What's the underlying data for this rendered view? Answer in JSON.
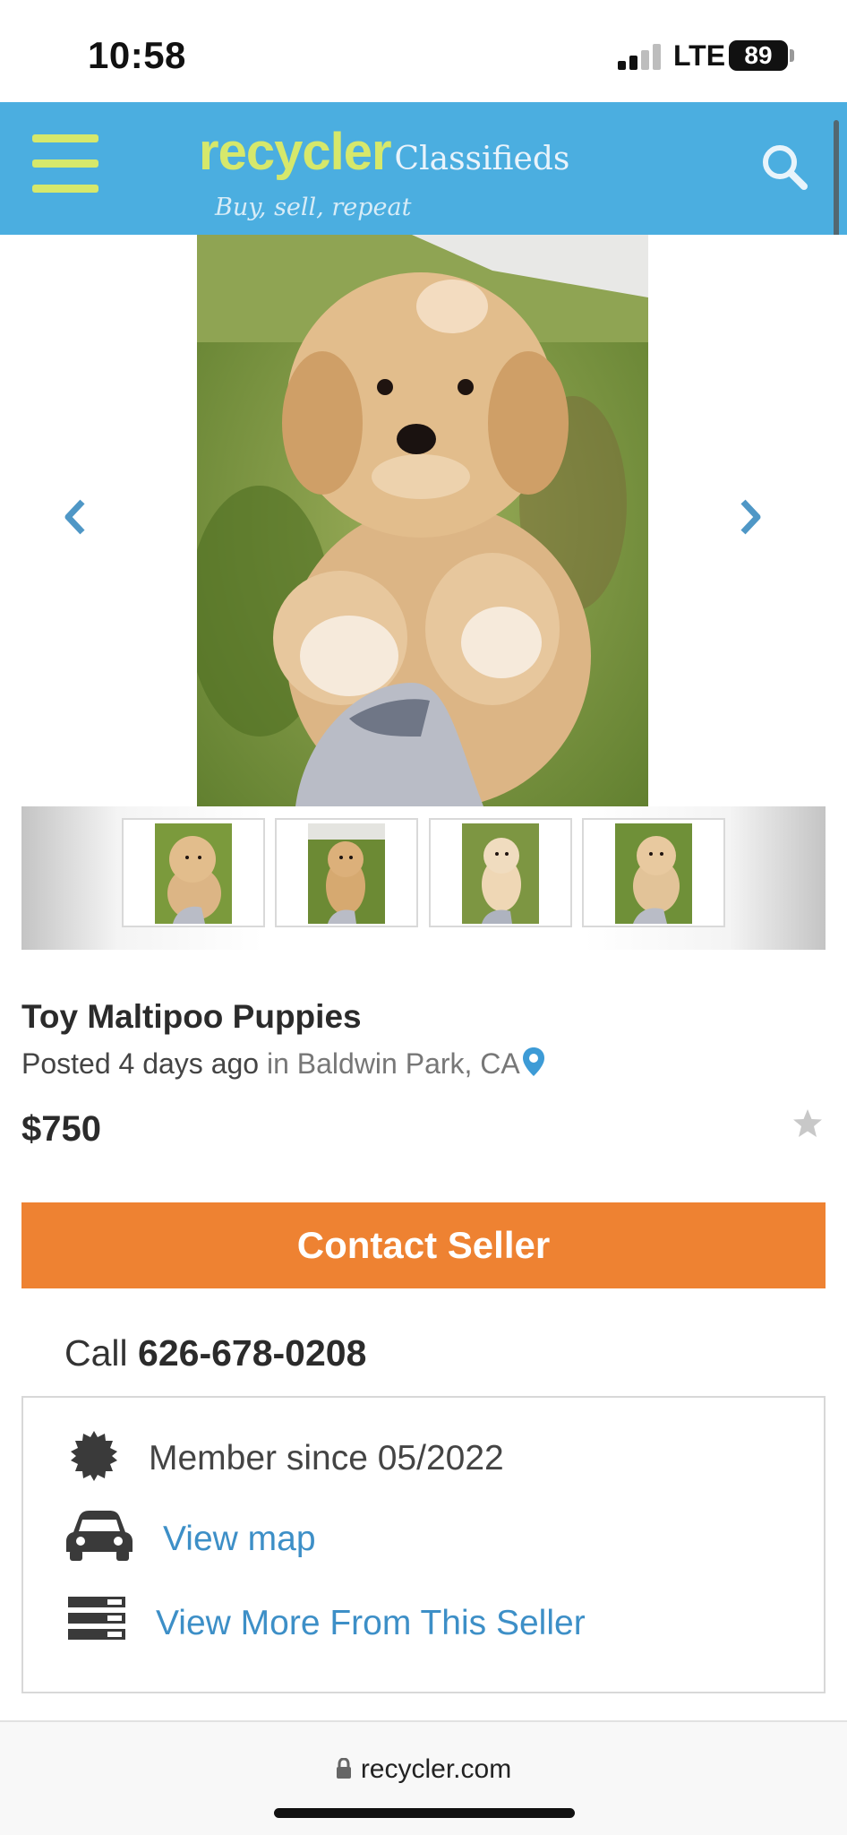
{
  "status_bar": {
    "time": "10:58",
    "network": "LTE",
    "battery": "89"
  },
  "header": {
    "logo_main": "recycler",
    "logo_sub": "Classifieds",
    "tagline": "Buy, sell, repeat",
    "brand_color": "#4baee0",
    "accent_color": "#d6e86b"
  },
  "gallery": {
    "thumbnail_count": 4,
    "thumbnails": [
      "thumbnail-1",
      "thumbnail-2",
      "thumbnail-3",
      "thumbnail-4"
    ]
  },
  "listing": {
    "title": "Toy Maltipoo Puppies",
    "posted": "Posted 4 days ago",
    "location": "in Baldwin Park, CA",
    "price": "$750"
  },
  "contact": {
    "button_label": "Contact Seller",
    "button_color": "#ee8232",
    "call_prefix": "Call",
    "phone": "626-678-0208"
  },
  "seller": {
    "member_since": "Member since 05/2022",
    "view_map": "View map",
    "view_more": "View More From This Seller"
  },
  "browser": {
    "url": "recycler.com"
  }
}
